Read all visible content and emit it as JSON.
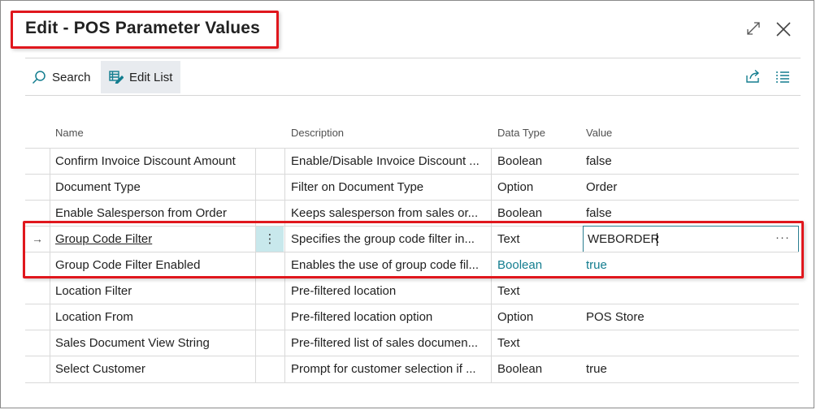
{
  "dialog": {
    "title": "Edit - POS Parameter Values",
    "expand_icon": "expand-icon",
    "close_icon": "close-icon"
  },
  "toolbar": {
    "search_label": "Search",
    "edit_list_label": "Edit List",
    "search_icon": "search-icon",
    "edit_list_icon": "edit-list-icon",
    "share_icon": "share-icon",
    "list_view_icon": "list-view-icon"
  },
  "grid": {
    "headers": {
      "name": "Name",
      "description": "Description",
      "data_type": "Data Type",
      "value": "Value"
    },
    "rows": [
      {
        "name": "Confirm Invoice Discount Amount",
        "description": "Enable/Disable Invoice Discount ...",
        "data_type": "Boolean",
        "value": "false"
      },
      {
        "name": "Document Type",
        "description": "Filter on Document Type",
        "data_type": "Option",
        "value": "Order"
      },
      {
        "name": "Enable Salesperson from Order",
        "description": "Keeps salesperson from sales or...",
        "data_type": "Boolean",
        "value": "false"
      },
      {
        "name": "Group Code Filter",
        "description": "Specifies the group code filter in...",
        "data_type": "Text",
        "value": "WEBORDER",
        "selector": "→",
        "row_menu": "⋮",
        "value_more": "···"
      },
      {
        "name": "Group Code Filter Enabled",
        "description": "Enables the use of group code fil...",
        "data_type": "Boolean",
        "value": "true"
      },
      {
        "name": "Location Filter",
        "description": "Pre-filtered location",
        "data_type": "Text",
        "value": ""
      },
      {
        "name": "Location From",
        "description": "Pre-filtered location option",
        "data_type": "Option",
        "value": "POS Store"
      },
      {
        "name": "Sales Document View String",
        "description": "Pre-filtered list of sales documen...",
        "data_type": "Text",
        "value": ""
      },
      {
        "name": "Select Customer",
        "description": "Prompt for customer selection if ...",
        "data_type": "Boolean",
        "value": "true"
      }
    ]
  },
  "colors": {
    "highlight": "#e0171d",
    "accent": "#137d8f",
    "active_button_bg": "#e8ebef"
  }
}
